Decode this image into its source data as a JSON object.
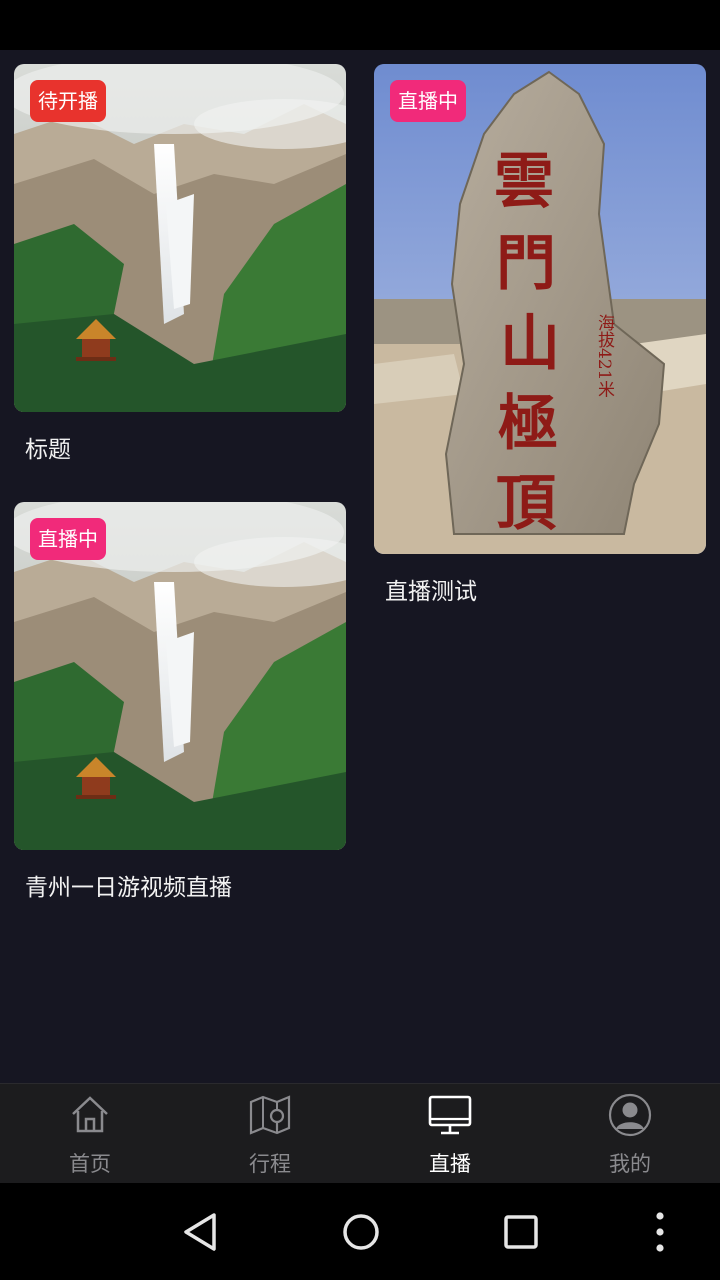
{
  "colors": {
    "background": "#161622",
    "badge_pending": "#e8332d",
    "badge_live": "#f12a7a",
    "tab_active": "#ffffff",
    "tab_inactive": "#8a8a8e"
  },
  "cards": [
    {
      "badge": "待开播",
      "title": "标题",
      "image": "waterfall-mountain-photo"
    },
    {
      "badge": "直播中",
      "title": "直播测试",
      "image": "stone-monument-photo",
      "monument_text": [
        "雲",
        "門",
        "山",
        "極",
        "頂"
      ],
      "monument_small_text": "海拔421米"
    },
    {
      "badge": "直播中",
      "title": "青州一日游视频直播",
      "image": "waterfall-mountain-photo"
    }
  ],
  "tabs": [
    {
      "label": "首页",
      "icon": "home-icon",
      "active": false
    },
    {
      "label": "行程",
      "icon": "map-icon",
      "active": false
    },
    {
      "label": "直播",
      "icon": "monitor-icon",
      "active": true
    },
    {
      "label": "我的",
      "icon": "user-icon",
      "active": false
    }
  ],
  "system_nav": [
    "back-icon",
    "home-circle-icon",
    "recents-icon",
    "more-icon"
  ]
}
